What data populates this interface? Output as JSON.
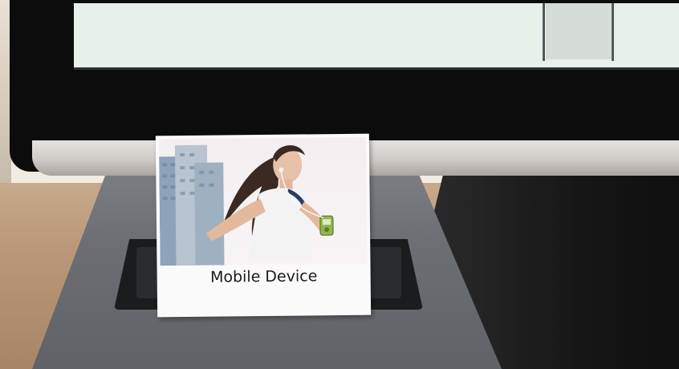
{
  "card": {
    "caption": "Mobile Device"
  },
  "scene": {
    "objects": [
      "computer-monitor",
      "monitor-stand",
      "printed-card",
      "desk"
    ]
  },
  "colors": {
    "desk": "#b89677",
    "stand": "#6c6f74",
    "monitor": "#0c0c0d",
    "card": "#fbfafa"
  }
}
